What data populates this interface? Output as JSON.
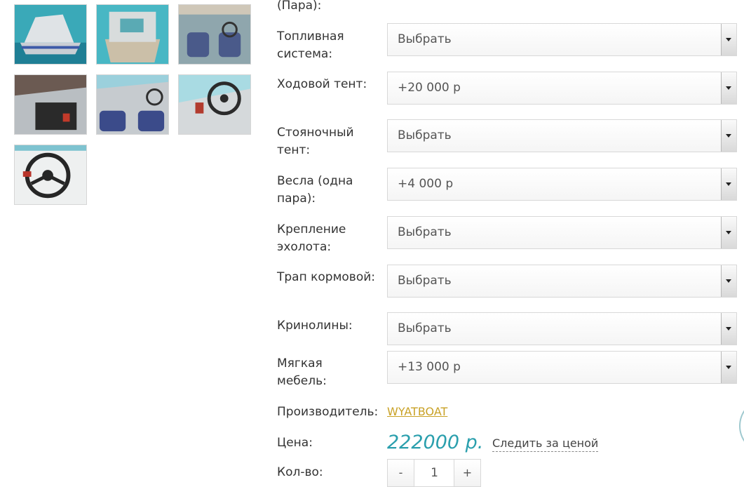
{
  "options": {
    "partial_label": "(Пара):",
    "rows": [
      {
        "label": "Топливная система:",
        "value": "Выбрать"
      },
      {
        "label": "Ходовой тент:",
        "value": "+20 000 р"
      },
      {
        "label": "Стояночный тент:",
        "value": "Выбрать"
      },
      {
        "label": "Весла (одна пара):",
        "value": "+4 000 р"
      },
      {
        "label": "Крепление эхолота:",
        "value": "Выбрать"
      },
      {
        "label": "Трап кормовой:",
        "value": "Выбрать"
      },
      {
        "label": "Кринолины:",
        "value": "Выбрать"
      },
      {
        "label": "Мягкая мебель:",
        "value": "+13 000 р"
      }
    ]
  },
  "product": {
    "maker_label": "Производитель:",
    "maker_value": "WYATBOAT",
    "price_label": "Цена:",
    "price_value": "222000 р.",
    "watch_price": "Следить за ценой",
    "qty_label": "Кол-во:",
    "qty_minus": "-",
    "qty_value": "1",
    "qty_plus": "+"
  },
  "icons": {
    "thumbnails": "boat-photo-thumbnail",
    "select_arrow": "chevron-down-icon"
  },
  "colors": {
    "price": "#2a9fad",
    "maker_link": "#c9a227"
  }
}
